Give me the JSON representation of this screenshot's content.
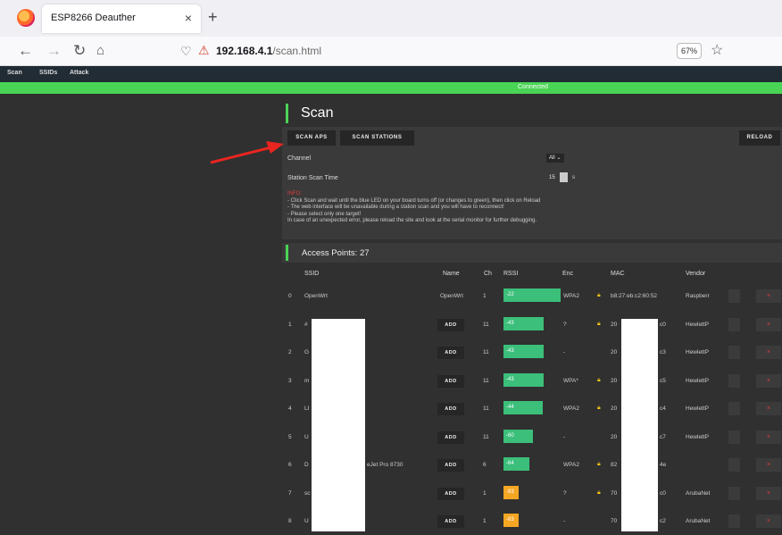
{
  "browser": {
    "tab_title": "ESP8266 Deauther",
    "close_glyph": "×",
    "new_tab_glyph": "+",
    "url_host": "192.168.4.1",
    "url_path": "/scan.html",
    "zoom": "67%"
  },
  "app": {
    "menu": [
      "Scan",
      "SSIDs",
      "Attack"
    ],
    "status": "Connected",
    "page_title": "Scan",
    "buttons": {
      "scan_aps": "SCAN APS",
      "scan_stations": "SCAN STATIONS",
      "reload": "RELOAD"
    },
    "channel_label": "Channel",
    "channel_value": "All",
    "station_time_label": "Station Scan Time",
    "station_time_value": "15",
    "station_time_unit": "s",
    "info": {
      "head": "INFO:",
      "lines": [
        "- Click Scan and wait until the blue LED on your board turns off (or changes to green), then click on Reload",
        "- The web interface will be unavailable during a station scan and you will have to reconnect!",
        "- Please select only one target!",
        "In case of an unexpected error, please reload the site and look at the serial monitor for further debugging."
      ]
    },
    "ap_title": "Access Points: 27",
    "columns": [
      "SSID",
      "Name",
      "Ch",
      "RSSI",
      "Enc",
      "MAC",
      "Vendor"
    ],
    "rows": [
      {
        "idx": "0",
        "ssid": "OpenWrt",
        "name": "OpenWrt",
        "ch": "1",
        "rssi": "-22",
        "rssi_level": 1.0,
        "color": "#3bbf7a",
        "enc": "WPA2",
        "lock": true,
        "mac": "b8:27:eb:c2:60:52",
        "vendor": "Raspberr"
      },
      {
        "idx": "1",
        "ssid": "#",
        "name": "ADD",
        "ch": "11",
        "rssi": "-43",
        "rssi_level": 0.7,
        "color": "#3bbf7a",
        "enc": "?",
        "lock": true,
        "mac": "20",
        "mac_end": "c0",
        "vendor": "HewlettP"
      },
      {
        "idx": "2",
        "ssid": "G",
        "name": "ADD",
        "ch": "11",
        "rssi": "-43",
        "rssi_level": 0.7,
        "color": "#3bbf7a",
        "enc": "-",
        "lock": false,
        "mac": "20",
        "mac_end": "c3",
        "vendor": "HewlettP"
      },
      {
        "idx": "3",
        "ssid": "m",
        "name": "ADD",
        "ch": "11",
        "rssi": "-43",
        "rssi_level": 0.7,
        "color": "#3bbf7a",
        "enc": "WPA*",
        "lock": true,
        "mac": "20",
        "mac_end": "c5",
        "vendor": "HewlettP"
      },
      {
        "idx": "4",
        "ssid": "LI",
        "name": "ADD",
        "ch": "11",
        "rssi": "-44",
        "rssi_level": 0.69,
        "color": "#3bbf7a",
        "enc": "WPA2",
        "lock": true,
        "mac": "20",
        "mac_end": "c4",
        "vendor": "HewlettP"
      },
      {
        "idx": "5",
        "ssid": "U",
        "name": "ADD",
        "ch": "11",
        "rssi": "-60",
        "rssi_level": 0.52,
        "color": "#3bbf7a",
        "enc": "-",
        "lock": false,
        "mac": "20",
        "mac_end": "c7",
        "vendor": "HewlettP"
      },
      {
        "idx": "6",
        "ssid": "D",
        "ssid_end": "eJet Pro 8730",
        "name": "ADD",
        "ch": "6",
        "rssi": "-64",
        "rssi_level": 0.46,
        "color": "#3bbf7a",
        "enc": "WPA2",
        "lock": true,
        "mac": "82",
        "mac_end": "4e",
        "vendor": ""
      },
      {
        "idx": "7",
        "ssid": "sc",
        "name": "ADD",
        "ch": "1",
        "rssi": "-83",
        "rssi_level": 0.27,
        "color": "#f5a623",
        "enc": "?",
        "lock": true,
        "mac": "70",
        "mac_end": "c0",
        "vendor": "ArubaNet"
      },
      {
        "idx": "8",
        "ssid": "U",
        "name": "ADD",
        "ch": "1",
        "rssi": "-83",
        "rssi_level": 0.27,
        "color": "#f5a623",
        "enc": "-",
        "lock": false,
        "mac": "70",
        "mac_end": "c2",
        "vendor": "ArubaNet"
      }
    ]
  }
}
